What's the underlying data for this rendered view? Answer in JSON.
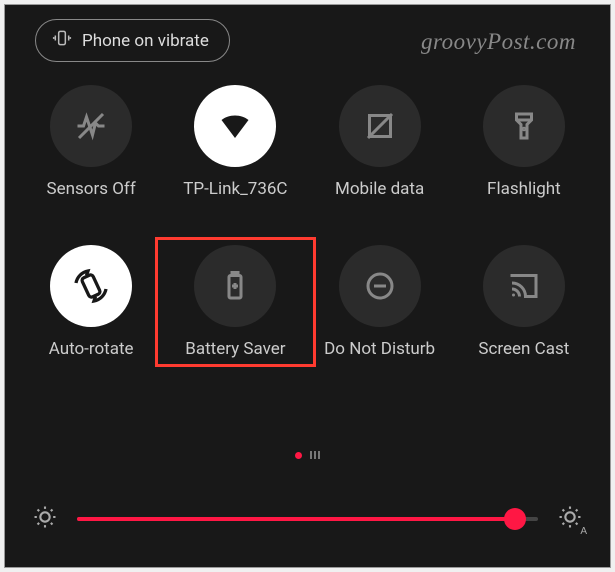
{
  "pill_label": "Phone on vibrate",
  "watermark": "groovyPost.com",
  "tiles": [
    {
      "label": "Sensors Off"
    },
    {
      "label": "TP-Link_736C"
    },
    {
      "label": "Mobile data"
    },
    {
      "label": "Flashlight"
    },
    {
      "label": "Auto-rotate"
    },
    {
      "label": "Battery Saver"
    },
    {
      "label": "Do Not Disturb"
    },
    {
      "label": "Screen Cast"
    }
  ],
  "brightness_percent": 95,
  "accent_color": "#ff1744",
  "highlight_color": "#ff3b30"
}
